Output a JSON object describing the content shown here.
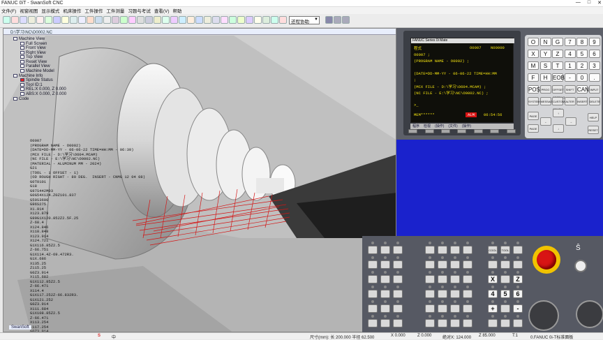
{
  "window": {
    "title": "FANUC 0iT - SwanSoft CNC",
    "status_program": "0.FANUC 0i-T标准面板"
  },
  "menu": [
    "文件(F)",
    "视窗视图",
    "显示模式",
    "机床操作",
    "工件操作",
    "工件测量",
    "习题与考试",
    "查看(V)",
    "帮助"
  ],
  "toolbar": {
    "mode_select": "还程协助"
  },
  "viewport": {
    "title": "D:\\学习\\NC\\O0002.NC",
    "tree": [
      "Machine View",
      "Full Screen",
      "Front View",
      "Right View",
      "Top View",
      "Reset View",
      "Parallel View",
      "Machine Model",
      "Machine Info",
      "Spindle Status",
      "Tool ID:1",
      "REL:X     0.000, Z     0.000",
      "ABS:X     0.000, Z     0.000",
      "Code"
    ],
    "code": [
      "O0007",
      "(PROGRAM NAME - O0002)",
      "(DATE=DD-MM-YY - 06-06-22 TIME=HH:MM - 06:39)",
      "(MCX FILE - D:\\学习\\O604.MCAM)",
      "(NC FILE - E:\\学习\\NC\\O0002.NC)",
      "(MATERIAL - ALUMINUM MM - 2024)",
      "G21",
      "(TOOL - 1 OFFSET - 1)",
      "(OD ROUGH RIGHT - 80 DEG.  INSERT - CNMG 12 04 08)",
      "G0T0101",
      "G18",
      "G97S442M03",
      "G0G54X124.Z0Z101.837",
      "G50S3600",
      "G96S275",
      "X1.914",
      "X123.879",
      "G99G1X120.852Z2.5F.25",
      "Z-68.4",
      "X124.846",
      "X118.848",
      "X123.914",
      "X124.721",
      "G1X116.85Z2.5",
      "Z-66.751",
      "G1X114.4Z-69.472R3.",
      "G1X.686",
      "X135.25",
      "Z115.25",
      "G0Z3.914",
      "X115.682",
      "G1X112.85Z2.5",
      "Z-66.471",
      "X114.4",
      "G1X117.252Z-66.832R3.",
      "G1X121.252",
      "G0Z3.914",
      "X111.684",
      "G1X108.85Z2.5",
      "Z-66.471",
      "X113.254",
      "X117.254",
      "G0Z3.914",
      "X107.686"
    ],
    "status": "SwanSoft"
  },
  "cnc_screen": {
    "header": "FANUC Series 0i Mate",
    "mode": "程式",
    "prog_no": "O0007",
    "seq_no": "N00000",
    "lines": [
      "O0007 ;",
      "(PROGRAM NAME - O0002) ;",
      "",
      "(DATE=DD-MM-YY - 06-06-22 TIME=HH:MM",
      ";",
      "(MCX FILE - D:\\学习\\O604.MCAM) ;",
      "(NC FILE - E:\\学习\\NC\\O0002.NC) ;",
      "",
      ">_"
    ],
    "footer_mode": "MEM******",
    "alarm": "ALM",
    "time": "06:54:56",
    "softkeys": [
      "程序",
      "检视",
      "(操作)",
      "(文件)",
      "(操作)"
    ]
  },
  "keypad": {
    "rows": [
      [
        "O",
        "N",
        "G",
        "7",
        "8",
        "9"
      ],
      [
        "X",
        "Y",
        "Z",
        "4",
        "5",
        "6"
      ],
      [
        "M",
        "S",
        "T",
        "1",
        "2",
        "3"
      ],
      [
        "F",
        "H",
        "EOB",
        "-",
        "0",
        "."
      ],
      [
        "POS",
        "PROG",
        "OFFSET SETTING",
        "SHIFT",
        "CAN",
        "INPUT"
      ],
      [
        "SYSTEM",
        "MESSAGE",
        "CUSTOM GRAPH",
        "ALTER",
        "INSERT",
        "DELETE"
      ]
    ],
    "nav": [
      "PAGE",
      "↑",
      "←",
      "↓",
      "→",
      "PAGE",
      "HELP",
      "RESET"
    ]
  },
  "panel_keys": {
    "letters": [
      "X",
      "Z",
      "4",
      "5",
      "6",
      "+",
      "-"
    ],
    "labels": [
      "COOL",
      "TOOL"
    ],
    "switch": "Ŝ"
  },
  "statusbar": {
    "size": "尺寸(mm): 长 200.000 半径 62.500",
    "x": "X 0.000",
    "z": "Z 0.000",
    "abs": "绝对X: 124.000",
    "absz": "Z 85.000",
    "tool": "T:1"
  },
  "taskbar": {
    "lang": "中",
    "app": "S"
  },
  "colors": {
    "screen_text": "#f0e010",
    "estop": "#d81414",
    "blue_area": "#1a22cc"
  }
}
